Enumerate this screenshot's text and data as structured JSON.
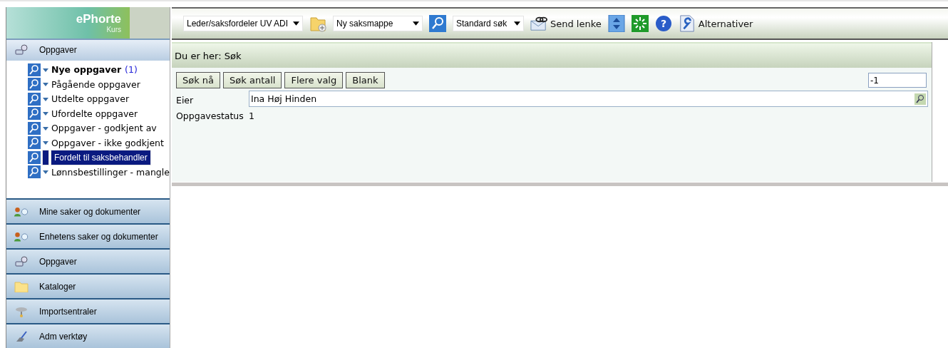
{
  "logo": {
    "name": "ePhorte",
    "sub": "Kurs"
  },
  "toolbar": {
    "role_select": "Leder/saksfordeler UV ADI",
    "new_select": "Ny saksmappe",
    "search_select": "Standard søk",
    "send_link": "Send lenke",
    "help": "?",
    "options": "Alternativer"
  },
  "sidebar": {
    "header": "Oppgaver",
    "items": [
      {
        "label": "Nye oppgaver",
        "count": "(1)",
        "bold": true,
        "selected": false
      },
      {
        "label": "Pågående oppgaver",
        "bold": false,
        "selected": false
      },
      {
        "label": "Utdelte oppgaver",
        "bold": false,
        "selected": false
      },
      {
        "label": "Ufordelte oppgaver",
        "bold": false,
        "selected": false
      },
      {
        "label": "Oppgaver - godkjent av",
        "bold": false,
        "selected": false
      },
      {
        "label": "Oppgaver - ikke godkjent",
        "bold": false,
        "selected": false
      },
      {
        "label": "Fordelt til saksbehandler",
        "bold": false,
        "selected": true
      },
      {
        "label": "Lønnsbestillinger - mangle",
        "bold": false,
        "selected": false
      }
    ],
    "nav": [
      {
        "kind": "people",
        "label": "Mine saker og dokumenter"
      },
      {
        "kind": "people",
        "label": "Enhetens saker og dokumenter"
      },
      {
        "kind": "tasks",
        "label": "Oppgaver"
      },
      {
        "kind": "folder",
        "label": "Kataloger"
      },
      {
        "kind": "import",
        "label": "Importsentraler"
      },
      {
        "kind": "tools",
        "label": "Adm verktøy"
      }
    ]
  },
  "breadcrumb": "Du er her: Søk",
  "buttons": [
    "Søk nå",
    "Søk antall",
    "Flere valg",
    "Blank"
  ],
  "count_field": "-1",
  "fields": [
    {
      "label": "Eier",
      "value": "Ina Høj Hinden"
    },
    {
      "label": "Oppgavestatus",
      "value": "1"
    }
  ]
}
